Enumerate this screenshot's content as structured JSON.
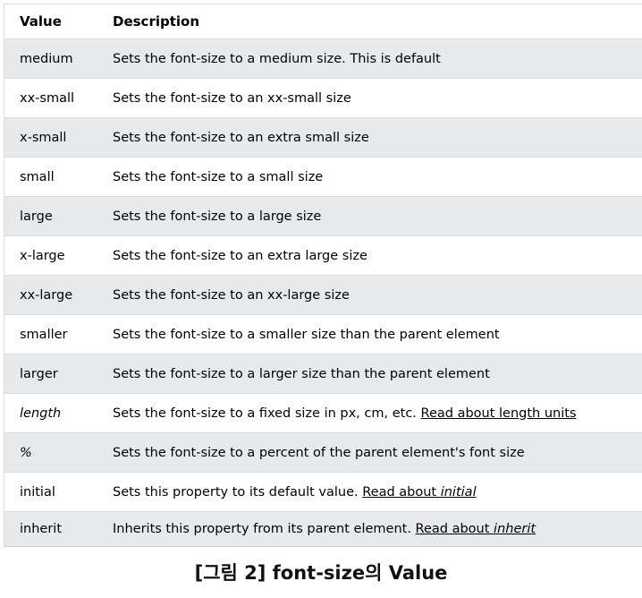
{
  "table": {
    "headers": {
      "value": "Value",
      "description": "Description"
    },
    "rows": [
      {
        "value": "medium",
        "description": "Sets the font-size to a medium size. This is default"
      },
      {
        "value": "xx-small",
        "description": "Sets the font-size to an xx-small size"
      },
      {
        "value": "x-small",
        "description": "Sets the font-size to an extra small size"
      },
      {
        "value": "small",
        "description": "Sets the font-size to a small size"
      },
      {
        "value": "large",
        "description": "Sets the font-size to a large size"
      },
      {
        "value": "x-large",
        "description": "Sets the font-size to an extra large size"
      },
      {
        "value": "xx-large",
        "description": "Sets the font-size to an xx-large size"
      },
      {
        "value": "smaller",
        "description": "Sets the font-size to a smaller size than the parent element"
      },
      {
        "value": "larger",
        "description": "Sets the font-size to a larger size than the parent element"
      },
      {
        "value": "length",
        "description": "Sets the font-size to a fixed size in px, cm, etc. ",
        "link": "Read about length units"
      },
      {
        "value": "%",
        "description": "Sets the font-size to a percent of  the parent element's font size"
      },
      {
        "value": "initial",
        "description": "Sets this property to its default value. ",
        "link_prefix": "Read about ",
        "link_em": "initial"
      },
      {
        "value": "inherit",
        "description": "Inherits this property from its parent element. ",
        "link_prefix": "Read about ",
        "link_em": "inherit"
      }
    ]
  },
  "caption": "[그림 2] font-size의 Value",
  "colors": {
    "alt_row": "#e7e9eb",
    "border": "#dddddd"
  }
}
